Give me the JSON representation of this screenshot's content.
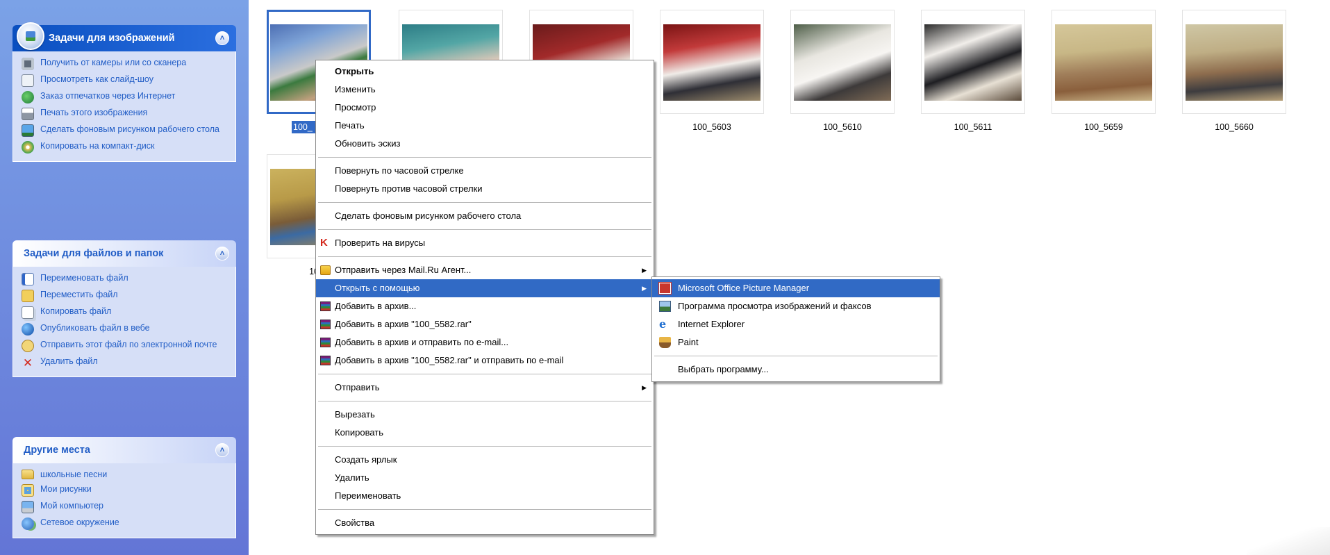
{
  "task_pane": {
    "image_tasks": {
      "title": "Задачи для изображений",
      "items": [
        {
          "label": "Получить от камеры или со сканера",
          "icon": "camera-icon"
        },
        {
          "label": "Просмотреть как слайд-шоу",
          "icon": "slideshow-icon"
        },
        {
          "label": "Заказ отпечатков через Интернет",
          "icon": "globe-icon"
        },
        {
          "label": "Печать этого изображения",
          "icon": "printer-icon"
        },
        {
          "label": "Сделать фоновым рисунком рабочего стола",
          "icon": "desktop-icon"
        },
        {
          "label": "Копировать на компакт-диск",
          "icon": "cd-icon"
        }
      ]
    },
    "file_tasks": {
      "title": "Задачи для файлов и папок",
      "items": [
        {
          "label": "Переименовать файл",
          "icon": "rename-icon"
        },
        {
          "label": "Переместить файл",
          "icon": "move-icon"
        },
        {
          "label": "Копировать файл",
          "icon": "copy-icon"
        },
        {
          "label": "Опубликовать файл в вебе",
          "icon": "web-publish-icon"
        },
        {
          "label": "Отправить этот файл по электронной почте",
          "icon": "email-icon"
        },
        {
          "label": "Удалить файл",
          "icon": "delete-icon"
        }
      ]
    },
    "other_places": {
      "title": "Другие места",
      "items": [
        {
          "label": "школьные песни",
          "icon": "folder-icon"
        },
        {
          "label": "Мои рисунки",
          "icon": "my-pictures-icon"
        },
        {
          "label": "Мой компьютер",
          "icon": "computer-icon"
        },
        {
          "label": "Сетевое окружение",
          "icon": "network-icon"
        }
      ]
    }
  },
  "thumbnails": [
    {
      "label": "100_",
      "selected": true
    },
    {
      "label": ""
    },
    {
      "label": ""
    },
    {
      "label": "100_5603"
    },
    {
      "label": "100_5610"
    },
    {
      "label": "100_5611"
    },
    {
      "label": "100_5659"
    },
    {
      "label": "100_5660"
    },
    {
      "label": "100_"
    }
  ],
  "context_menu": {
    "groups": [
      [
        {
          "label": "Открыть",
          "bold": true
        },
        {
          "label": "Изменить"
        },
        {
          "label": "Просмотр"
        },
        {
          "label": "Печать"
        },
        {
          "label": "Обновить эскиз"
        }
      ],
      [
        {
          "label": "Повернуть по часовой стрелке"
        },
        {
          "label": "Повернуть против часовой стрелки"
        }
      ],
      [
        {
          "label": "Сделать фоновым рисунком рабочего стола"
        }
      ],
      [
        {
          "label": "Проверить на вирусы",
          "icon": "antivirus-icon"
        }
      ],
      [
        {
          "label": "Отправить через Mail.Ru Агент...",
          "icon": "mailru-agent-icon",
          "submenu": true
        },
        {
          "label": "Открыть с помощью",
          "submenu": true,
          "highlighted": true
        },
        {
          "label": "Добавить в архив...",
          "icon": "winrar-icon"
        },
        {
          "label": "Добавить в архив \"100_5582.rar\"",
          "icon": "winrar-icon"
        },
        {
          "label": "Добавить в архив и отправить по e-mail...",
          "icon": "winrar-icon"
        },
        {
          "label": "Добавить в архив \"100_5582.rar\" и отправить по e-mail",
          "icon": "winrar-icon"
        }
      ],
      [
        {
          "label": "Отправить",
          "submenu": true
        }
      ],
      [
        {
          "label": "Вырезать"
        },
        {
          "label": "Копировать"
        }
      ],
      [
        {
          "label": "Создать ярлык"
        },
        {
          "label": "Удалить"
        },
        {
          "label": "Переименовать"
        }
      ],
      [
        {
          "label": "Свойства"
        }
      ]
    ]
  },
  "open_with_submenu": {
    "programs": [
      {
        "label": "Microsoft Office Picture Manager",
        "icon": "picture-manager-icon",
        "highlighted": true
      },
      {
        "label": "Программа просмотра изображений и факсов",
        "icon": "image-viewer-icon"
      },
      {
        "label": "Internet Explorer",
        "icon": "internet-explorer-icon"
      },
      {
        "label": "Paint",
        "icon": "paint-icon"
      }
    ],
    "choose_program": "Выбрать программу..."
  },
  "colors": {
    "highlight": "#316ac5",
    "task_pane_link": "#215dc6",
    "task_pane_background": "#6375d6"
  }
}
